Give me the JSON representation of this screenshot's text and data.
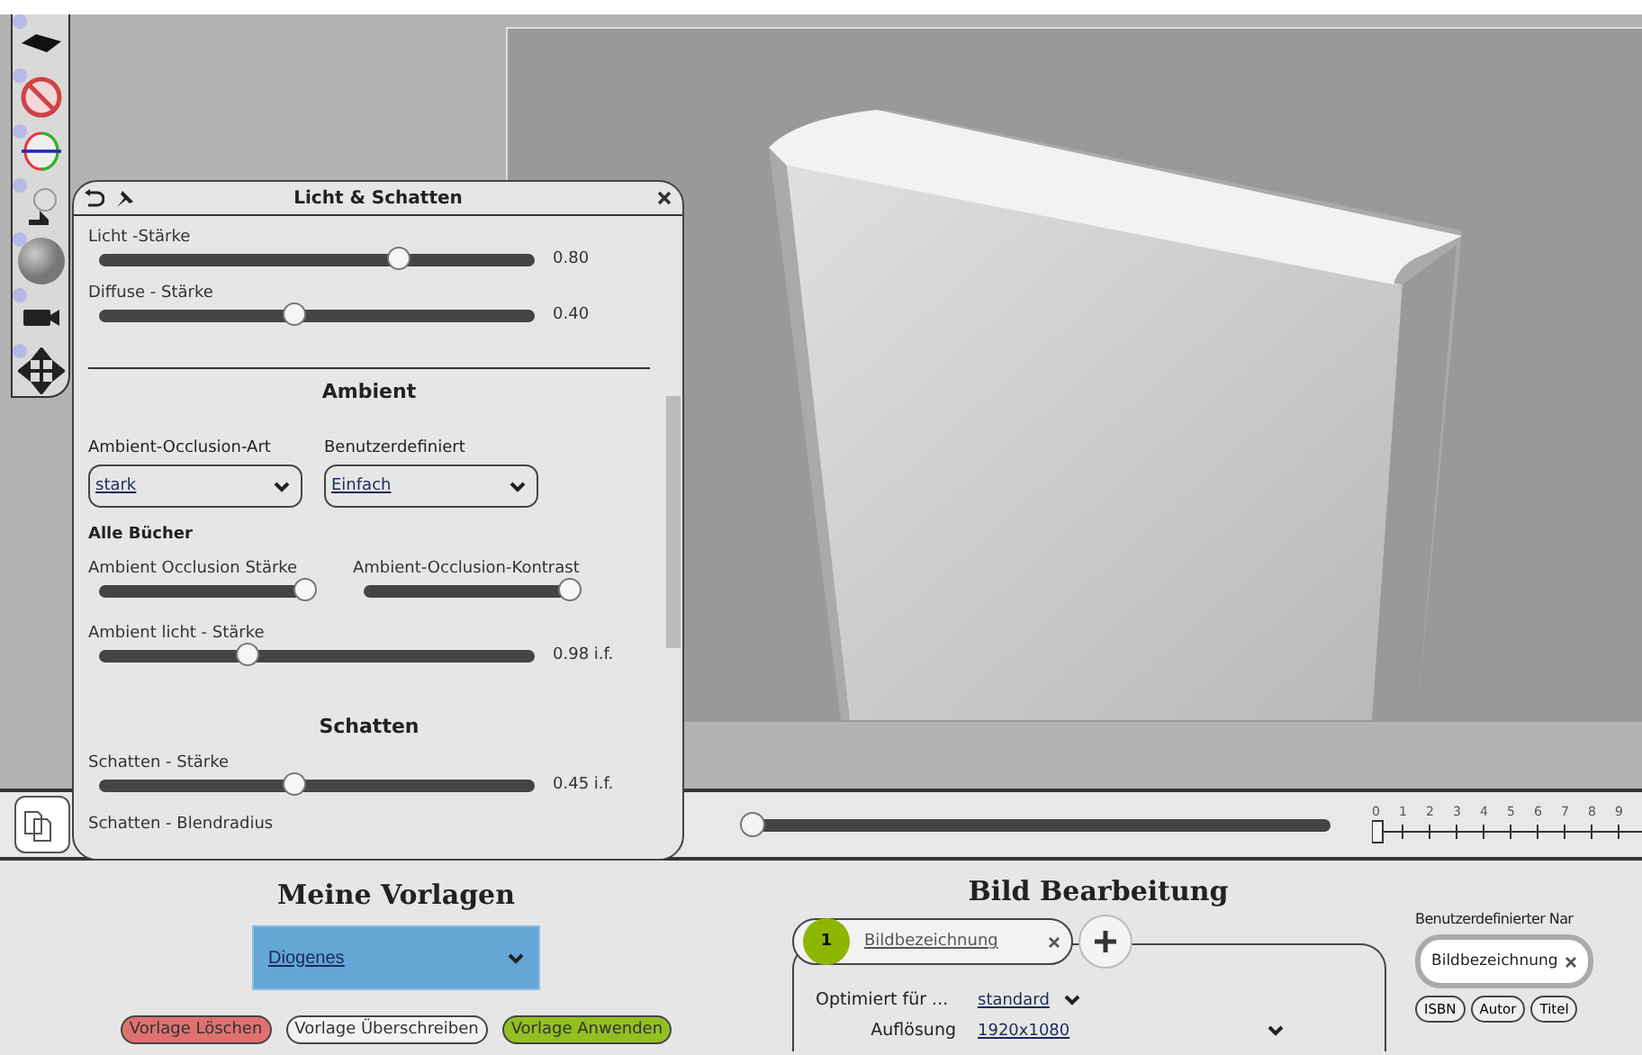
{
  "panel": {
    "title": "Licht & Schatten",
    "items": [
      {
        "kind": "slider",
        "label": "Licht -Stärke",
        "level": 0.69,
        "reading": "0.80"
      },
      {
        "kind": "slider",
        "label": "Diffuse - Stärke",
        "level": 0.45,
        "reading": "0.40"
      },
      {
        "kind": "heading",
        "label": "Ambient"
      },
      {
        "kind": "selects",
        "fields": [
          {
            "label": "Ambient-Occlusion-Art",
            "value": "stark"
          },
          {
            "label": "Benutzerdefiniert",
            "value": "Einfach"
          }
        ]
      },
      {
        "kind": "subheading",
        "label": "Alle Bücher"
      },
      {
        "kind": "slider_pair",
        "sliders": [
          {
            "label": "Ambient Occlusion Stärke",
            "level": 1.0
          },
          {
            "label": "Ambient-Occlusion-Kontrast",
            "level": 1.0
          }
        ]
      },
      {
        "kind": "slider",
        "label": "Ambient licht - Stärke",
        "level": 0.34,
        "reading": "0.98 i.f."
      },
      {
        "kind": "heading",
        "label": "Schatten"
      },
      {
        "kind": "slider",
        "label": "Schatten - Stärke",
        "level": 0.45,
        "reading": "0.45 i.f."
      },
      {
        "kind": "label",
        "label": "Schatten - Blendradius"
      }
    ]
  },
  "timeline": {
    "level": 0,
    "ticks": [
      "0",
      "1",
      "2",
      "3",
      "4",
      "5",
      "6",
      "7",
      "8",
      "9"
    ]
  },
  "templates": {
    "title": "Meine Vorlagen",
    "value": "Diogenes",
    "buttons": [
      {
        "label": "Vorlage Löschen",
        "kind": "danger"
      },
      {
        "label": "Vorlage Überschreiben",
        "kind": "neutral"
      },
      {
        "label": "Vorlage Anwenden",
        "kind": "confirm"
      }
    ]
  },
  "editing": {
    "title": "Bild Bearbeitung",
    "tabs": [
      {
        "number": "1",
        "label": "Bildbezeichnung",
        "selected": true
      }
    ],
    "fields": [
      {
        "label": "Optimiert für ...",
        "value": "standard"
      },
      {
        "label": "Auflösung",
        "value": "1920x1080"
      }
    ]
  },
  "naming": {
    "title": "Benutzerdefinierter Nar",
    "tokens": [
      "Bildbezeichnung"
    ],
    "chips": [
      "ISBN",
      "Autor",
      "Titel"
    ]
  }
}
